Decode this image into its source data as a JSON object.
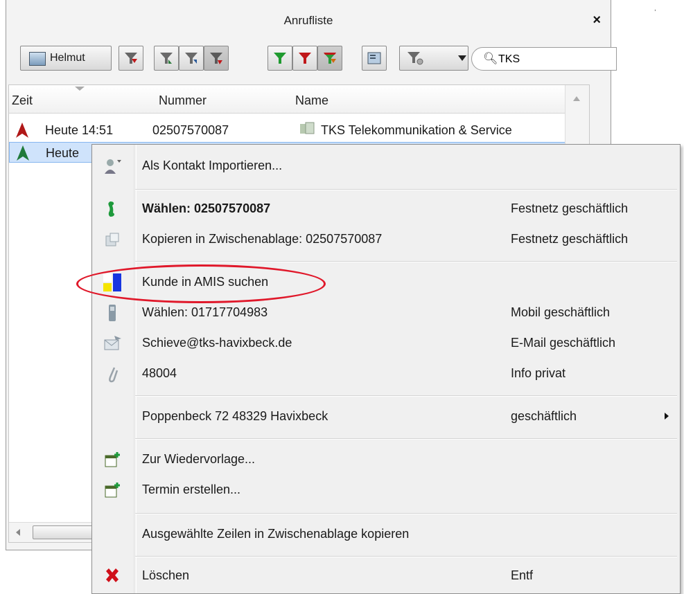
{
  "window": {
    "title": "Anrufliste",
    "close_glyph": "×"
  },
  "toolbar": {
    "user_button": "Helmut",
    "search": {
      "value": "TKS",
      "placeholder": ""
    },
    "icons": [
      "user-card-icon",
      "filter-red-icon",
      "filter-a-icon",
      "filter-b-icon",
      "filter-c-icon",
      "filter-green-icon",
      "filter-red2-icon",
      "filter-mixed-icon",
      "card-icon",
      "filter-options-icon",
      "dropdown-arrow",
      "search-icon"
    ]
  },
  "table": {
    "columns": [
      "Zeit",
      "Nummer",
      "Name"
    ],
    "rows": [
      {
        "time": "Heute 14:51",
        "number": "02507570087",
        "name": "TKS Telekommunikation & Service",
        "direction": "outgoing"
      },
      {
        "time": "Heute",
        "number": "",
        "name": "",
        "direction": "incoming"
      }
    ]
  },
  "menu": {
    "items": [
      {
        "label": "Als Kontakt Importieren...",
        "sub": "",
        "icon": "import-contact-icon"
      },
      {
        "label": "Wählen: 02507570087",
        "sub": "Festnetz geschäftlich",
        "icon": "phone-icon",
        "bold": true
      },
      {
        "label": "Kopieren in Zwischenablage: 02507570087",
        "sub": "Festnetz geschäftlich",
        "icon": "copy-icon"
      },
      {
        "label": "Kunde in AMIS suchen",
        "sub": "",
        "icon": "amis-icon"
      },
      {
        "label": "Wählen: 01717704983",
        "sub": "Mobil geschäftlich",
        "icon": "mobile-icon"
      },
      {
        "label": "Schieve@tks-havixbeck.de",
        "sub": "E-Mail geschäftlich",
        "icon": "email-icon"
      },
      {
        "label": "48004",
        "sub": "Info privat",
        "icon": "paperclip-icon"
      },
      {
        "label": "Poppenbeck 72 48329 Havixbeck",
        "sub": "geschäftlich",
        "icon": ""
      },
      {
        "label": "Zur Wiedervorlage...",
        "sub": "",
        "icon": "calendar-add-icon"
      },
      {
        "label": "Termin erstellen...",
        "sub": "",
        "icon": "calendar-add-icon"
      },
      {
        "label": "Ausgewählte Zeilen in Zwischenablage kopieren",
        "sub": "",
        "icon": ""
      },
      {
        "label": "Löschen",
        "sub": "Entf",
        "icon": "delete-icon"
      }
    ]
  },
  "colors": {
    "highlight": "#e0182a",
    "selection": "#cfe3fb"
  }
}
